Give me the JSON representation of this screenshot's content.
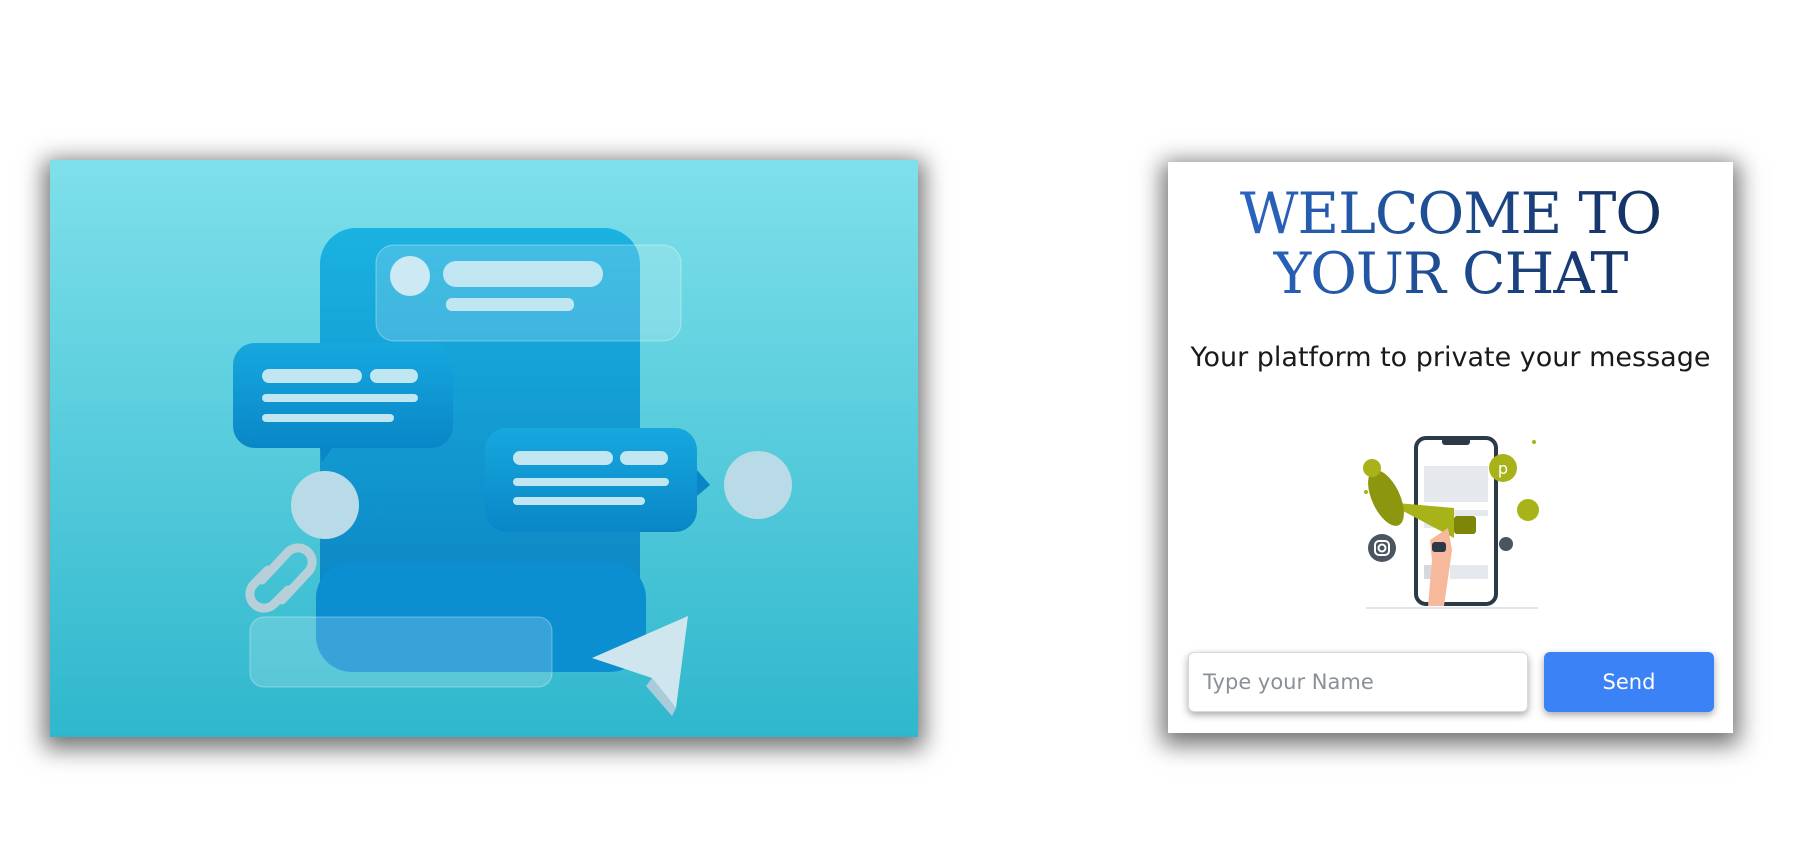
{
  "hero": {
    "icon": "chat-bubbles-illustration",
    "background_top": "#7ee0ea",
    "background_bottom": "#2fb7cd"
  },
  "welcome": {
    "title_line1": "WELCOME TO",
    "title_line2": "YOUR CHAT",
    "subtitle": "Your platform to private your message",
    "illustration_icon": "megaphone-phone-illustration"
  },
  "form": {
    "name_placeholder": "Type your Name",
    "name_value": "",
    "send_label": "Send",
    "accent": "#3b82f6"
  }
}
